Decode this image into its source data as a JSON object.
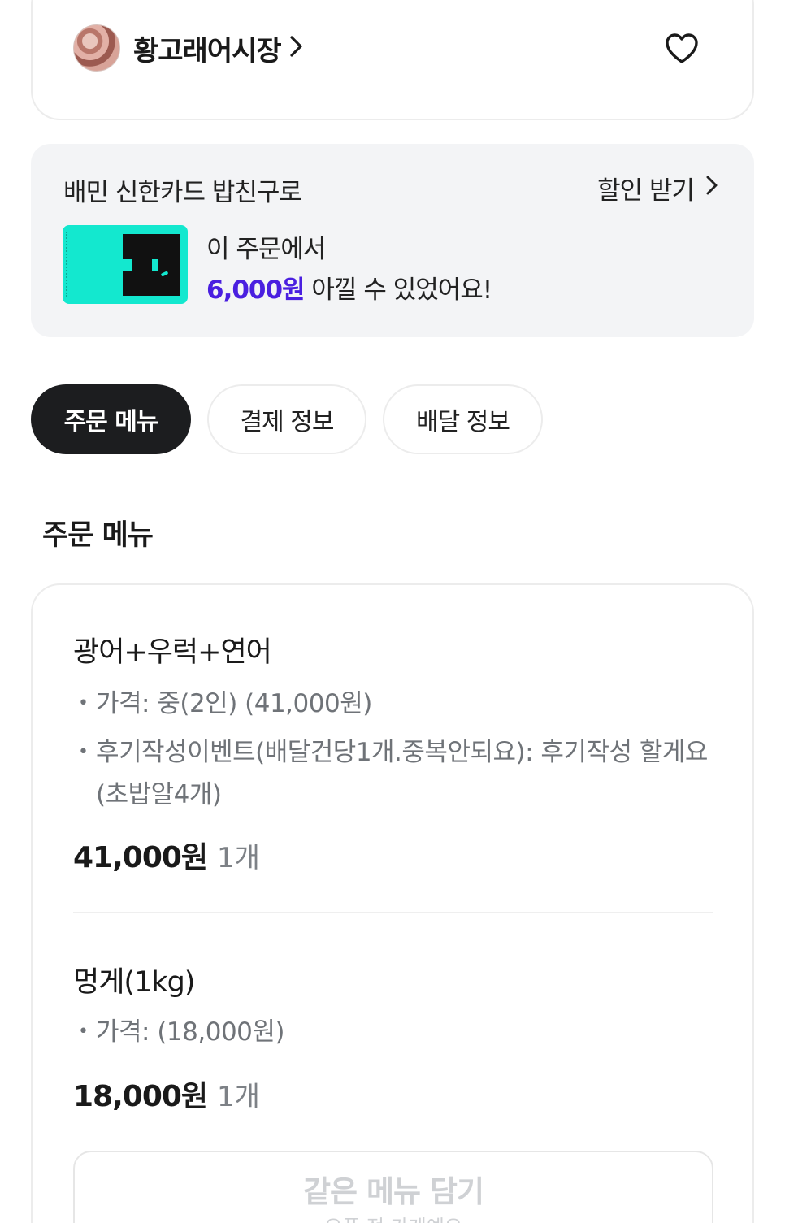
{
  "store": {
    "name": "황고래어시장",
    "avatar_icon": "store-logo-avatar",
    "favorite_icon": "heart-icon"
  },
  "promo": {
    "title": "배민 신한카드 밥친구로",
    "action_label": "할인 받기",
    "line1": "이 주문에서",
    "amount": "6,000원",
    "line2_suffix": " 아낄 수 있었어요!",
    "card_color": "#13e8cf",
    "amount_color": "#4a1fe0"
  },
  "tabs": [
    {
      "label": "주문 메뉴",
      "active": true
    },
    {
      "label": "결제 정보",
      "active": false
    },
    {
      "label": "배달 정보",
      "active": false
    }
  ],
  "section_title": "주문 메뉴",
  "order_items": [
    {
      "name": "광어+우럭+연어",
      "options": [
        "가격: 중(2인) (41,000원)",
        "후기작성이벤트(배달건당1개.중복안되요): 후기작성 할게요(초밥알4개)"
      ],
      "price": "41,000원",
      "qty": "1개"
    },
    {
      "name": "멍게(1kg)",
      "options": [
        "가격:  (18,000원)"
      ],
      "price": "18,000원",
      "qty": "1개"
    }
  ],
  "add_same_menu": {
    "label": "같은 메뉴 담기",
    "sub": "오픈 전 가게예요"
  }
}
